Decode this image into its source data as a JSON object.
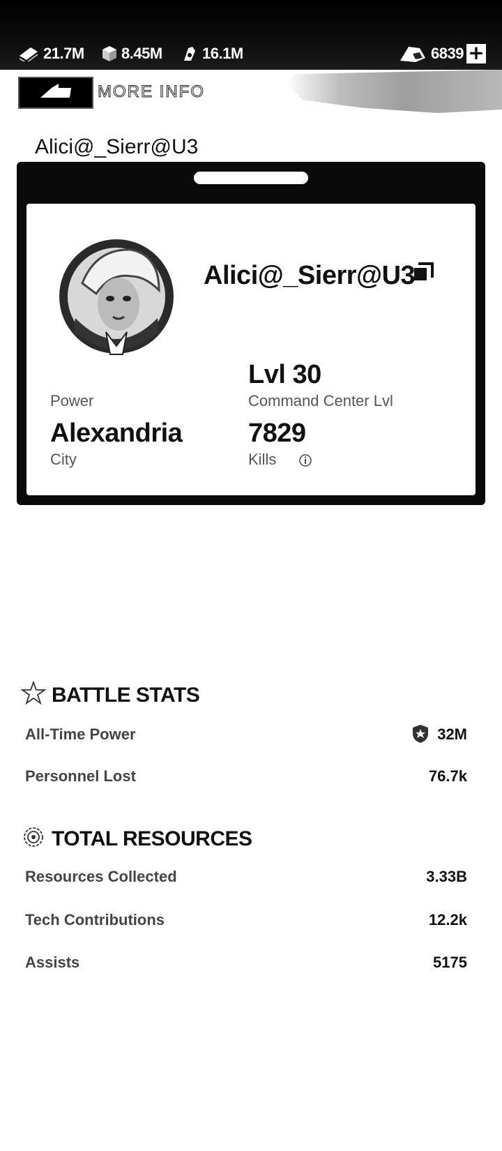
{
  "topbar": {
    "resources": [
      {
        "icon": "cash-icon",
        "value": "21.7M"
      },
      {
        "icon": "crate-icon",
        "value": "8.45M"
      },
      {
        "icon": "fuel-icon",
        "value": "16.1M"
      }
    ],
    "premium": {
      "icon": "gem-icon",
      "value": "6839"
    },
    "plus_label": "+"
  },
  "header": {
    "more_info": "MORE INFO"
  },
  "profile": {
    "page_name": "Alici@_Sierr@U3",
    "player_name": "Alici@_Sierr@U3",
    "level_value": "Lvl 30",
    "level_label": "Command Center Lvl",
    "power_label": "Power",
    "city_value": "Alexandria",
    "city_label": "City",
    "kills_value": "7829",
    "kills_label": "Kills"
  },
  "battle_stats": {
    "title": "BATTLE STATS",
    "rows": [
      {
        "label": "All-Time Power",
        "value": "32M"
      },
      {
        "label": "Personnel Lost",
        "value": "76.7k"
      }
    ]
  },
  "total_resources": {
    "title": "TOTAL RESOURCES",
    "rows": [
      {
        "label": "Resources Collected",
        "value": "3.33B"
      },
      {
        "label": "Tech Contributions",
        "value": "12.2k"
      },
      {
        "label": "Assists",
        "value": "5175"
      }
    ]
  }
}
